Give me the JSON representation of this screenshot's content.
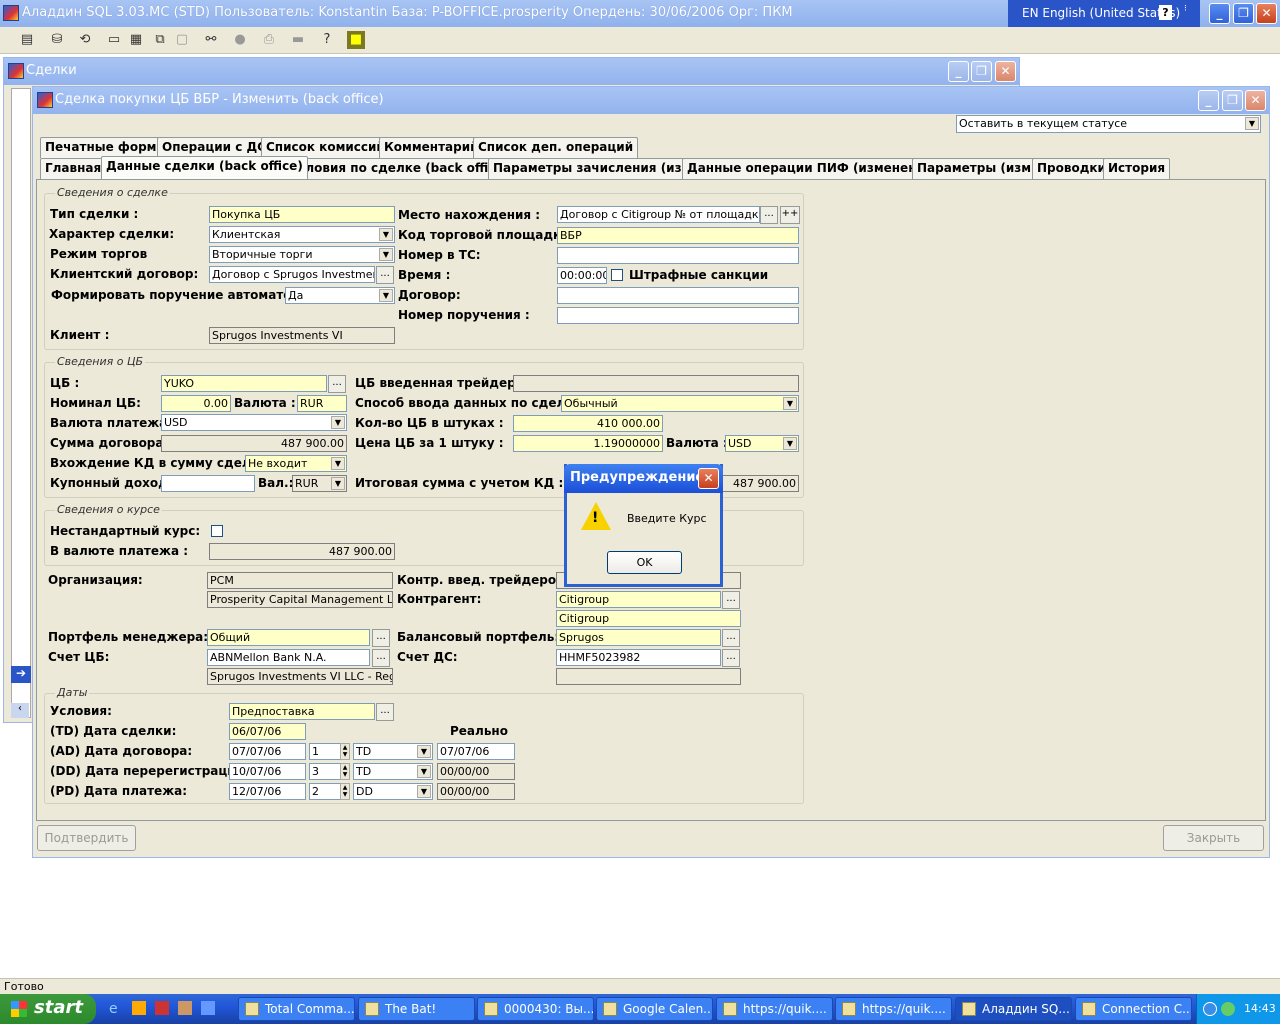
{
  "app": {
    "title": "Аладдин SQL 3.03.MC (STD)  Пользователь: Konstantin База: P-BOFFICE.prosperity Опердень: 30/06/2006 Орг: ПКМ",
    "language": "EN English (United States)"
  },
  "toolbar": {
    "icons": [
      "list-icon",
      "database-icon",
      "refresh-icon",
      "window-icon",
      "tile-icon",
      "cascade-icon",
      "frame-icon",
      "binoculars-icon",
      "stop-icon",
      "print-icon",
      "folder-icon",
      "help-icon",
      "book-icon"
    ]
  },
  "deals_window": {
    "title": "Сделки"
  },
  "deal_window": {
    "title": "Сделка покупки ЦБ ВБР - Изменить (back office)",
    "status_select": "Оставить в текущем статусе",
    "tabs_row1": [
      "Печатные формы",
      "Операции с ДС",
      "Список комиссий",
      "Комментарий",
      "Список деп. операций"
    ],
    "tabs_row2": [
      "Главная",
      "Данные сделки (back office)",
      "Условия по сделке (back office)",
      "Параметры зачисления (изм.)",
      "Данные операции ПИФ (изменение)",
      "Параметры (изм.)",
      "Проводки",
      "История"
    ]
  },
  "deal_info": {
    "caption": "Сведения о сделке",
    "deal_type_label": "Тип сделки :",
    "deal_type": "Покупка ЦБ",
    "character_label": "Характер сделки:",
    "character": "Клиентская",
    "trade_mode_label": "Режим торгов",
    "trade_mode": "Вторичные торги",
    "client_contract_label": "Клиентский договор:",
    "client_contract": "Договор с Sprugos Investments VI",
    "auto_order_label": "Формировать поручение автоматом:",
    "auto_order": "Да",
    "client_label": "Клиент :",
    "client": "Sprugos Investments VI",
    "location_label": "Место нахождения :",
    "location": "Договор с Citigroup №  от  площадка ВБР",
    "location_more": "...",
    "location_plus": "++",
    "venue_code_label": "Код торговой площадки :",
    "venue_code": "ВБР",
    "ts_number_label": "Номер в ТС:",
    "ts_number": "",
    "time_label": "Время :",
    "time": "00:00:00",
    "penalty_label": "Штрафные санкции",
    "contract_label": "Договор:",
    "contract": "",
    "order_number_label": "Номер поручения :",
    "order_number": ""
  },
  "security_info": {
    "caption": "Сведения о ЦБ",
    "security_label": "ЦБ :",
    "security": "YUKO",
    "trader_security_label": "ЦБ введенная трейдером:",
    "trader_security": "",
    "nominal_label": "Номинал ЦБ:",
    "nominal": "0.00",
    "currency_label": "Валюта :",
    "currency": "RUR",
    "input_method_label": "Способ ввода данных по сделке :",
    "input_method": "Обычный",
    "payment_currency_label": "Валюта платежа :",
    "payment_currency": "USD",
    "quantity_label": "Кол-во ЦБ в штуках :",
    "quantity": "410 000.00",
    "contract_sum_label": "Сумма договора :",
    "contract_sum": "487 900.00",
    "price_label": "Цена ЦБ за 1 штуку :",
    "price": "1.19000000",
    "price_currency_label": "Валюта :",
    "price_currency": "USD",
    "accrued_label": "Вхождение КД в сумму сделки :",
    "accrued": "Не входит",
    "coupon_label": "Купонный доход :",
    "coupon": "",
    "coupon_currency_label": "Вал.:",
    "coupon_currency": "RUR",
    "total_label": "Итоговая сумма с учетом КД :",
    "total": "487 900.00"
  },
  "rate_info": {
    "caption": "Сведения о курсе",
    "nonstandard_label": "Нестандартный курс:",
    "in_payment_currency_label": "В валюте платежа :",
    "in_payment_currency": "487 900.00"
  },
  "parties": {
    "organization_label": "Организация:",
    "organization_code": "PCM",
    "organization_name": "Prosperity Capital Management Ltd",
    "trader_counterparty_label": "Контр. введ. трейдером:",
    "counterparty_label": "Контрагент:",
    "counterparty": "Citigroup",
    "counterparty_name": "Citigroup",
    "manager_portfolio_label": "Портфель менеджера:",
    "manager_portfolio": "Общий",
    "balance_portfolio_label": "Балансовый портфель:",
    "balance_portfolio": "Sprugos",
    "security_account_label": "Счет ЦБ:",
    "security_account": "ABNMellon Bank N.A.",
    "security_account_holder": "Sprugos Investments VI LLC - Registra",
    "cash_account_label": "Счет ДС:",
    "cash_account": "HHMF5023982"
  },
  "dates": {
    "caption": "Даты",
    "terms_label": "Условия:",
    "terms": "Предпоставка",
    "actual_label": "Реально",
    "td_label": "(TD) Дата сделки:",
    "td": "06/07/06",
    "ad_label": "(AD) Дата договора:",
    "ad": "07/07/06",
    "ad_days": "1",
    "ad_base": "TD",
    "ad_actual": "07/07/06",
    "dd_label": "(DD) Дата перерегистрации:",
    "dd": "10/07/06",
    "dd_days": "3",
    "dd_base": "TD",
    "dd_actual": "00/00/00",
    "pd_label": "(PD) Дата платежа:",
    "pd": "12/07/06",
    "pd_days": "2",
    "pd_base": "DD",
    "pd_actual": "00/00/00"
  },
  "buttons": {
    "confirm": "Подтвердить",
    "close": "Закрыть"
  },
  "dialog": {
    "title": "Предупреждение!",
    "message": "Введите Курс",
    "ok": "OK"
  },
  "status_bar": {
    "text": "Готово"
  },
  "taskbar": {
    "start": "start",
    "tasks": [
      "Total Comma...",
      "The Bat!",
      "0000430: Вы...",
      "Google Calen...",
      "https://quik....",
      "https://quik....",
      "Аладдин SQ...",
      "Connection C..."
    ],
    "clock": "14:43"
  }
}
